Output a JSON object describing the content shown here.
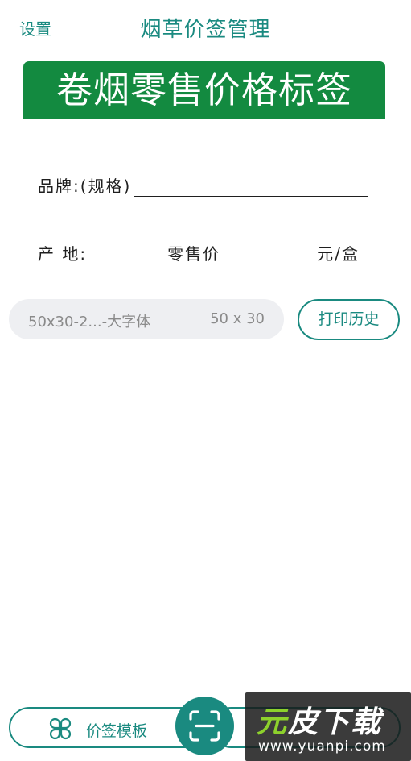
{
  "header": {
    "settings_label": "设置",
    "title": "烟草价签管理"
  },
  "label_preview": {
    "banner_title": "卷烟零售价格标签",
    "brand_label": "品牌:(规格)",
    "origin_label": "产 地:",
    "price_label": "零售价",
    "unit_label": "元/盒"
  },
  "template_selector": {
    "name": "50x30-2...-大字体",
    "size": "50 x 30"
  },
  "history_button_label": "打印历史",
  "bottom_bar": {
    "template_button_label": "价签模板",
    "template_icon": "clover-icon",
    "scan_icon": "scan-icon"
  },
  "watermark": {
    "logo_part1": "元",
    "logo_part2": "皮下载",
    "url": "www.yuanpi.com"
  },
  "colors": {
    "accent": "#1a8a80",
    "banner_green": "#138a40",
    "select_bg": "#eeeff2"
  }
}
